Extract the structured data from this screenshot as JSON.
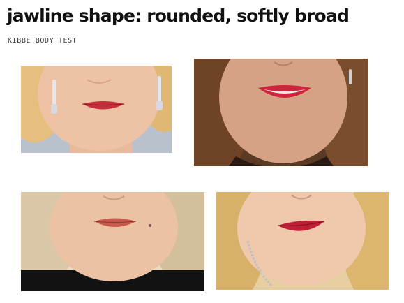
{
  "title": "jawline shape: rounded, softly broad",
  "subtitle": "KIBBE BODY TEST",
  "photos": [
    {
      "name": "photo-blonde-earrings",
      "skin": "#eec2a4",
      "hair": "#e6be7e",
      "bg": "#b9c2cc",
      "lips": "#c62c3a",
      "accessory": "earring"
    },
    {
      "name": "photo-brunette-smile",
      "skin": "#d6a286",
      "hair": "#6e4326",
      "bg": "#5b3a24",
      "lips": "#d0243c",
      "accessory": "earring"
    },
    {
      "name": "photo-blonde-black-top",
      "skin": "#ecc2a4",
      "hair": "#d9c7a7",
      "bg": "#e8d9c0",
      "lips": "#c75a4c",
      "accessory": "black-top"
    },
    {
      "name": "photo-blonde-necklace",
      "skin": "#f0c8ac",
      "hair": "#d7b06a",
      "bg": "#e7cfa1",
      "lips": "#c01e36",
      "accessory": "necklace"
    }
  ]
}
